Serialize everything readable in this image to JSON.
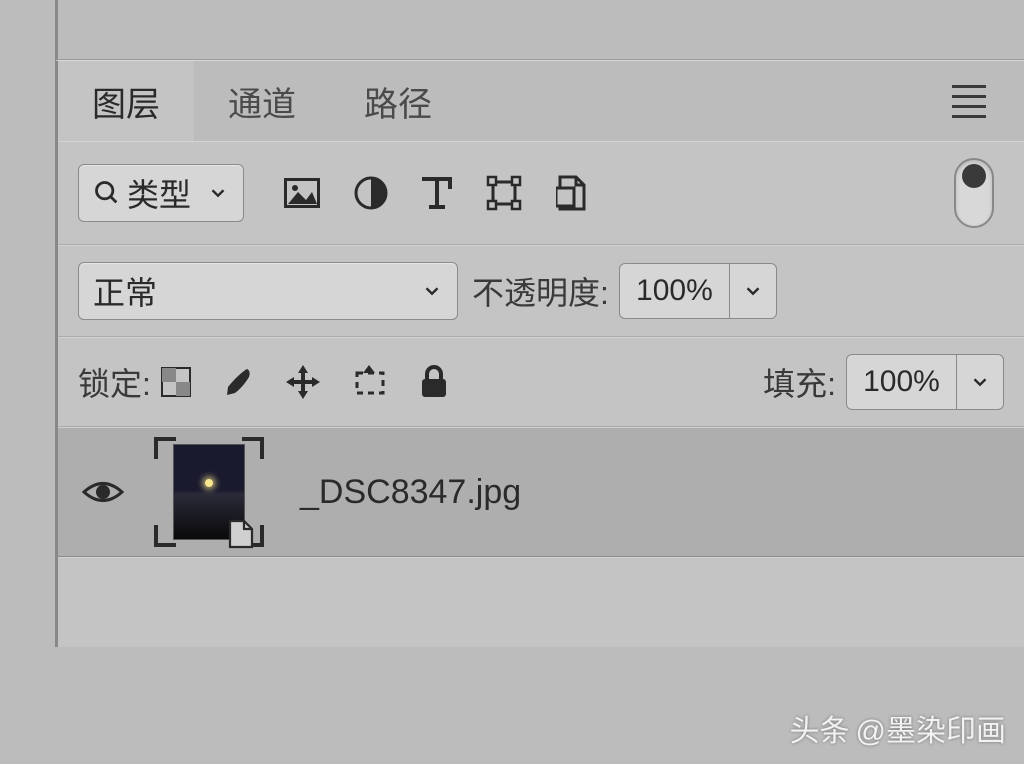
{
  "tabs": {
    "layers": "图层",
    "channels": "通道",
    "paths": "路径"
  },
  "filter": {
    "kind_label": "类型",
    "icon_search": "search-icon",
    "icon_pixel": "image-icon",
    "icon_adjust": "adjustment-icon",
    "icon_text": "text-icon",
    "icon_shape": "shape-icon",
    "icon_smart": "smart-object-icon"
  },
  "blend": {
    "mode": "正常",
    "opacity_label": "不透明度:",
    "opacity_value": "100%"
  },
  "lock": {
    "label": "锁定:",
    "fill_label": "填充:",
    "fill_value": "100%"
  },
  "layer": {
    "name": "_DSC8347.jpg"
  },
  "watermark": {
    "prefix": "头条",
    "handle": "@墨染印画"
  }
}
